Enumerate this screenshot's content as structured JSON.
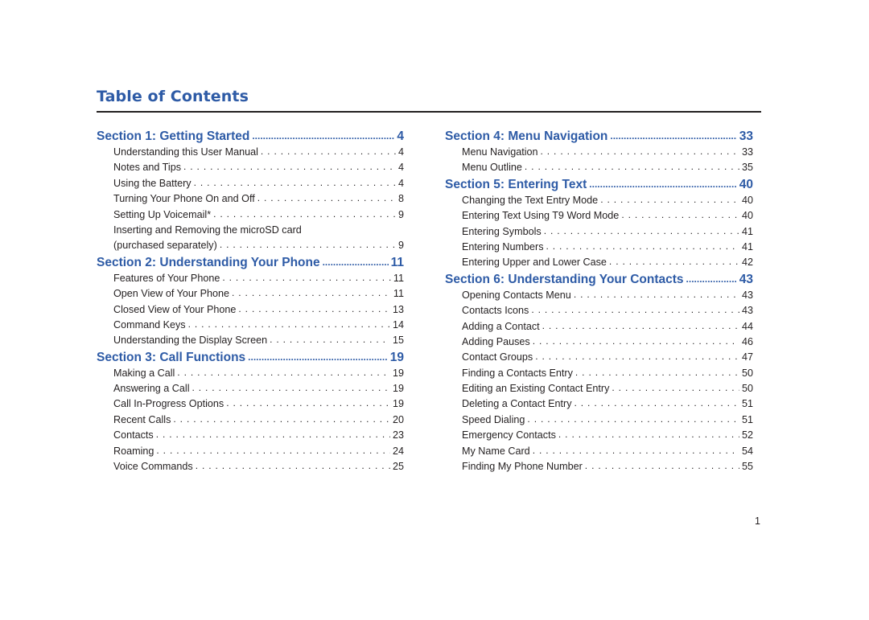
{
  "title": "Table of Contents",
  "page_number": "1",
  "colors": {
    "section_heading": "#2e5ba6",
    "body_text": "#231f20"
  },
  "left_column": [
    {
      "type": "section",
      "label": "Section 1:  Getting Started",
      "page": "4"
    },
    {
      "type": "entry",
      "label": "Understanding this User Manual",
      "page": "4"
    },
    {
      "type": "entry",
      "label": "Notes and Tips",
      "page": "4"
    },
    {
      "type": "entry",
      "label": "Using the Battery",
      "page": "4"
    },
    {
      "type": "entry",
      "label": "Turning Your Phone On and Off",
      "page": "8"
    },
    {
      "type": "entry",
      "label": "Setting Up Voicemail*",
      "page": "9"
    },
    {
      "type": "entry-continued",
      "label": "Inserting and Removing the microSD card",
      "page": ""
    },
    {
      "type": "entry",
      "label": "(purchased separately)",
      "page": "9"
    },
    {
      "type": "section",
      "label": "Section 2:  Understanding Your Phone",
      "page": "11"
    },
    {
      "type": "entry",
      "label": "Features of Your Phone",
      "page": "11"
    },
    {
      "type": "entry",
      "label": "Open View of Your Phone",
      "page": "11"
    },
    {
      "type": "entry",
      "label": "Closed View of Your Phone",
      "page": "13"
    },
    {
      "type": "entry",
      "label": "Command Keys",
      "page": "14"
    },
    {
      "type": "entry",
      "label": "Understanding the Display Screen",
      "page": "15"
    },
    {
      "type": "section",
      "label": "Section 3:   Call Functions",
      "page": "19"
    },
    {
      "type": "entry",
      "label": "Making a Call",
      "page": "19"
    },
    {
      "type": "entry",
      "label": "Answering a Call",
      "page": "19"
    },
    {
      "type": "entry",
      "label": "Call In-Progress Options",
      "page": "19"
    },
    {
      "type": "entry",
      "label": "Recent Calls",
      "page": "20"
    },
    {
      "type": "entry",
      "label": "Contacts",
      "page": "23"
    },
    {
      "type": "entry",
      "label": "Roaming",
      "page": "24"
    },
    {
      "type": "entry",
      "label": "Voice Commands",
      "page": "25"
    }
  ],
  "right_column": [
    {
      "type": "section",
      "label": "Section 4:  Menu Navigation",
      "page": "33"
    },
    {
      "type": "entry",
      "label": "Menu Navigation",
      "page": "33"
    },
    {
      "type": "entry",
      "label": "Menu Outline",
      "page": "35"
    },
    {
      "type": "section",
      "label": "Section 5:  Entering Text",
      "page": "40"
    },
    {
      "type": "entry",
      "label": "Changing the Text Entry Mode",
      "page": "40"
    },
    {
      "type": "entry",
      "label": "Entering Text Using T9 Word Mode",
      "page": "40"
    },
    {
      "type": "entry",
      "label": "Entering Symbols",
      "page": "41"
    },
    {
      "type": "entry",
      "label": "Entering Numbers",
      "page": "41"
    },
    {
      "type": "entry",
      "label": "Entering Upper and Lower Case",
      "page": "42"
    },
    {
      "type": "section",
      "label": "Section 6:  Understanding Your Contacts",
      "page": "43"
    },
    {
      "type": "entry",
      "label": "Opening Contacts Menu",
      "page": "43"
    },
    {
      "type": "entry",
      "label": "Contacts Icons",
      "page": "43"
    },
    {
      "type": "entry",
      "label": "Adding a Contact",
      "page": "44"
    },
    {
      "type": "entry",
      "label": "Adding Pauses",
      "page": "46"
    },
    {
      "type": "entry",
      "label": "Contact Groups",
      "page": "47"
    },
    {
      "type": "entry",
      "label": "Finding a Contacts Entry",
      "page": "50"
    },
    {
      "type": "entry",
      "label": "Editing an Existing Contact Entry",
      "page": "50"
    },
    {
      "type": "entry",
      "label": "Deleting a Contact Entry",
      "page": "51"
    },
    {
      "type": "entry",
      "label": "Speed Dialing",
      "page": "51"
    },
    {
      "type": "entry",
      "label": "Emergency Contacts",
      "page": "52"
    },
    {
      "type": "entry",
      "label": "My Name Card",
      "page": "54"
    },
    {
      "type": "entry",
      "label": "Finding My Phone Number",
      "page": "55"
    }
  ]
}
